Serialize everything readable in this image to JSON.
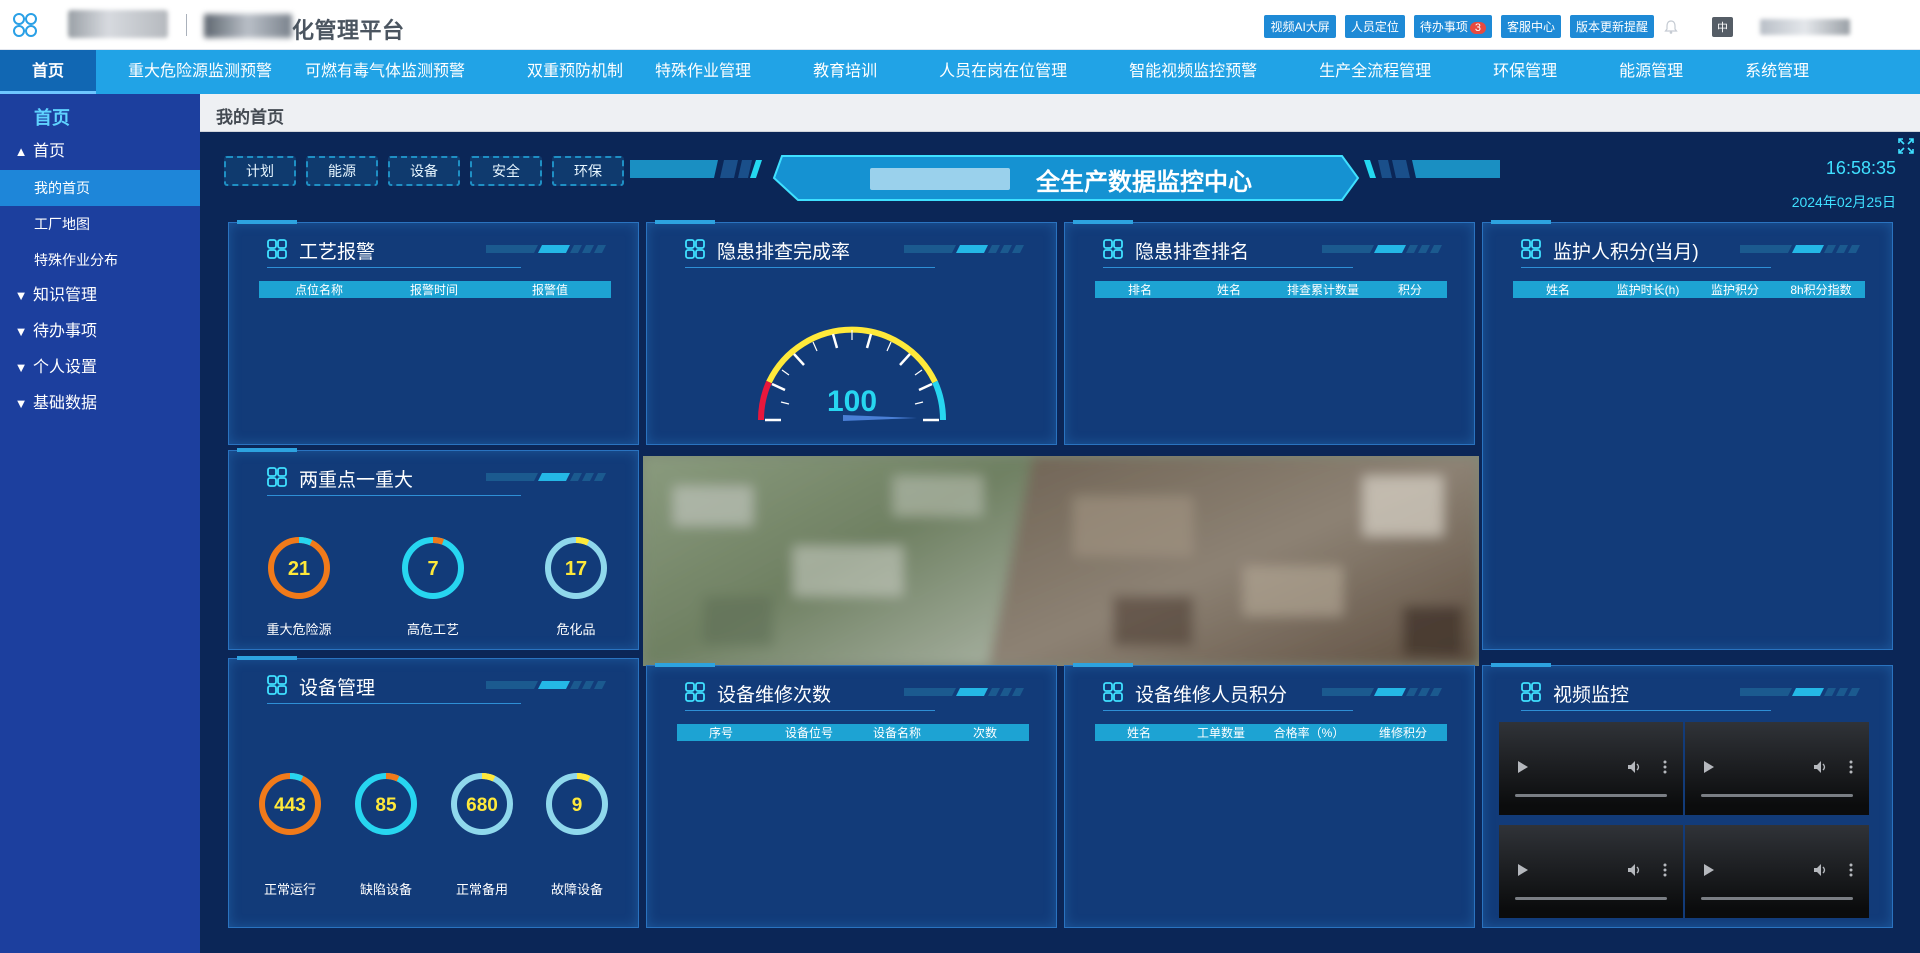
{
  "header": {
    "platform_title": "化管理平台",
    "actions": [
      "视频AI大屏",
      "人员定位",
      "待办事项",
      "客服中心",
      "版本更新提醒"
    ],
    "todo_count": "3",
    "lang": "中"
  },
  "nav": {
    "items": [
      "首页",
      "重大危险源监测预警",
      "可燃有毒气体监测预警",
      "双重预防机制",
      "特殊作业管理",
      "教育培训",
      "人员在岗在位管理",
      "智能视频监控预警",
      "生产全流程管理",
      "环保管理",
      "能源管理",
      "系统管理"
    ]
  },
  "sidebar": {
    "home_label": "首页",
    "groups": [
      {
        "label": "首页",
        "expanded": true,
        "children": [
          "我的首页",
          "工厂地图",
          "特殊作业分布"
        ]
      },
      {
        "label": "知识管理",
        "expanded": false
      },
      {
        "label": "待办事项",
        "expanded": false
      },
      {
        "label": "个人设置",
        "expanded": false
      },
      {
        "label": "基础数据",
        "expanded": false
      }
    ]
  },
  "content": {
    "breadcrumb": "我的首页",
    "quick_tabs": [
      "计划",
      "能源",
      "设备",
      "安全",
      "环保"
    ],
    "banner_title": "全生产数据监控中心",
    "time": "16:58:35",
    "date": "2024年02月25日"
  },
  "panels": {
    "process_alarm": {
      "title": "工艺报警",
      "columns": [
        "点位名称",
        "报警时间",
        "报警值"
      ]
    },
    "hazard_rate": {
      "title": "隐患排查完成率",
      "value": "100"
    },
    "hazard_rank": {
      "title": "隐患排查排名",
      "columns": [
        "排名",
        "姓名",
        "排查累计数量",
        "积分"
      ]
    },
    "guardian_points": {
      "title": "监护人积分(当月)",
      "columns": [
        "姓名",
        "监护时长(h)",
        "监护积分",
        "8h积分指数"
      ]
    },
    "two_key": {
      "title": "两重点一重大",
      "rings": [
        {
          "value": "21",
          "label": "重大危险源",
          "color": "#f07a1a"
        },
        {
          "value": "7",
          "label": "高危工艺",
          "color": "#27d6f0"
        },
        {
          "value": "17",
          "label": "危化品",
          "color": "#8fd8ec"
        }
      ]
    },
    "equipment": {
      "title": "设备管理",
      "rings": [
        {
          "value": "443",
          "label": "正常运行",
          "color": "#f07a1a"
        },
        {
          "value": "85",
          "label": "缺陷设备",
          "color": "#27d6f0"
        },
        {
          "value": "680",
          "label": "正常备用",
          "color": "#8fd8ec"
        },
        {
          "value": "9",
          "label": "故障设备",
          "color": "#8fd8ec"
        }
      ]
    },
    "repair_count": {
      "title": "设备维修次数",
      "columns": [
        "序号",
        "设备位号",
        "设备名称",
        "次数"
      ]
    },
    "repair_points": {
      "title": "设备维修人员积分",
      "columns": [
        "姓名",
        "工单数量",
        "合格率（%）",
        "维修积分"
      ]
    },
    "video": {
      "title": "视频监控"
    }
  },
  "colors": {
    "nav_bg": "#21a3e6",
    "sidebar_bg": "#1c3f9e",
    "dashboard_bg": "#0b2657",
    "panel_bg": "#123b79",
    "accent_cyan": "#3fe0ff",
    "ring_value_yellow": "#ffe93a",
    "table_header": "#1da3d3"
  }
}
